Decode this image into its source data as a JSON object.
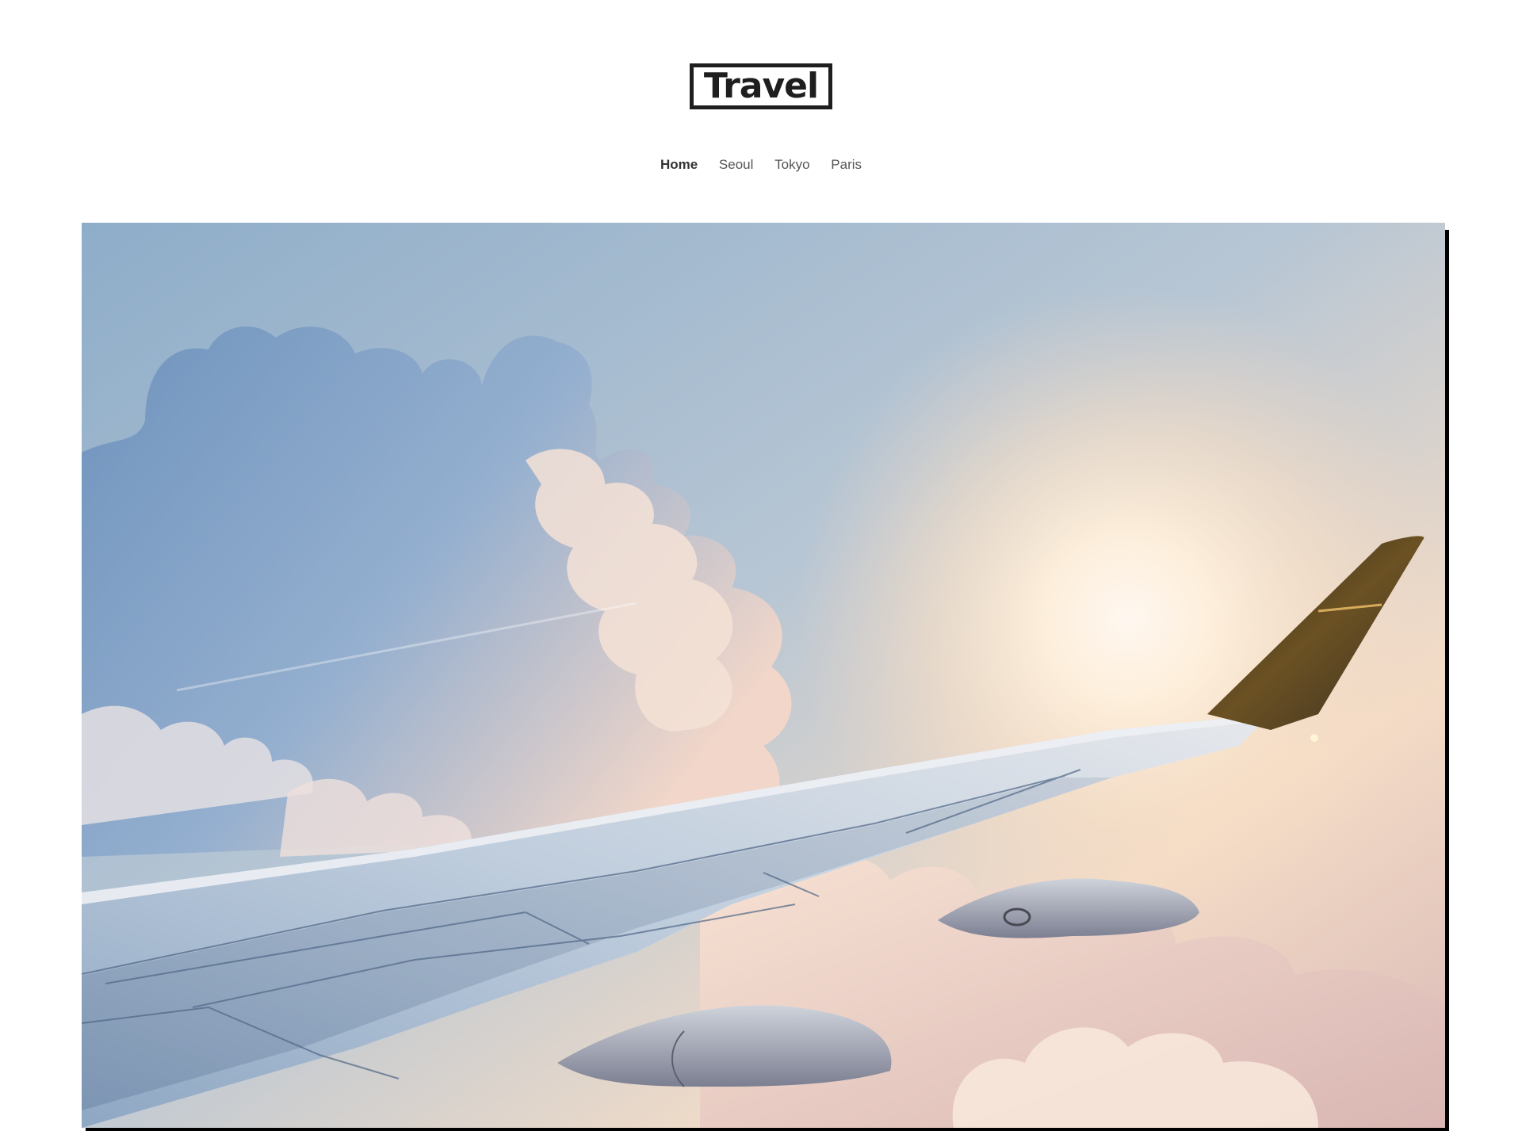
{
  "site": {
    "logo_text": "Travel"
  },
  "nav": {
    "items": [
      {
        "label": "Home",
        "active": true
      },
      {
        "label": "Seoul",
        "active": false
      },
      {
        "label": "Tokyo",
        "active": false
      },
      {
        "label": "Paris",
        "active": false
      }
    ]
  },
  "hero": {
    "subject": "airplane wing above clouds at sunset",
    "colors": {
      "sky_top": "#9fb4c8",
      "sky_glow": "#fde9cf",
      "cloud_blue": "#6f93bd",
      "cloud_warm": "#f6d8c4",
      "wing": "#b8c7da",
      "winglet": "#3f3320"
    }
  }
}
